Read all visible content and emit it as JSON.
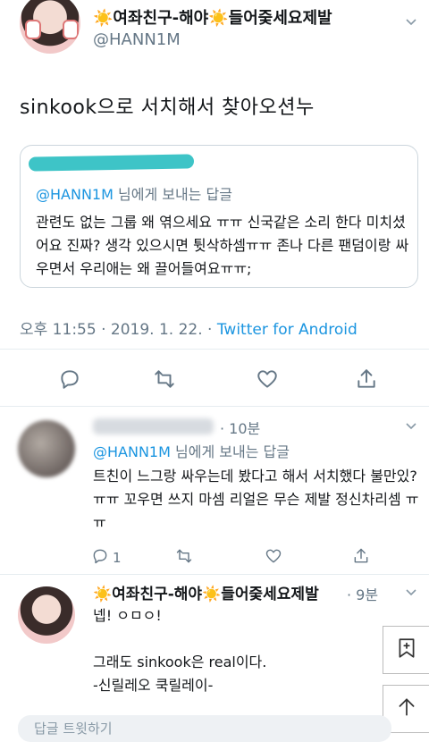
{
  "main_tweet": {
    "display_name": "☀️여좌친구-해야☀️들어줒세요제발",
    "handle": "@HANN1M",
    "text": "sinkook으로 서치해서 찾아오션누",
    "quote": {
      "reply_prefix": "@HANN1M",
      "reply_suffix": "님에게 보내는 답글",
      "body": "관련도 없는 그룹 왜 엮으세요 ㅠㅠ 신국같은 소리 한다 미치셨어요 진짜? 생각 있으시면 튓삭하셈ㅠㅠ 존나 다른 팬덤이랑 싸우면서 우리애는 왜 끌어들여요ㅠㅠ;"
    },
    "timestamp": "오후 11:55 · 2019. 1. 22. · ",
    "source": "Twitter for Android"
  },
  "reply1": {
    "time": "· 10분",
    "reply_prefix": "@HANN1M",
    "reply_suffix": "님에게 보내는 답글",
    "body": "트친이 느그랑 싸우는데 봤다고 해서 서치했다 불만있? ㅠㅠ 꼬우면 쓰지 마셈 리얼은 무슨 제발 정신차리셈 ㅠㅠ",
    "reply_count": "1"
  },
  "reply2": {
    "display_name": "☀️여좌친구-해야☀️들어줒세요제발",
    "time": "· 9분",
    "body": "넵! ㅇㅁㅇ!\n\n그래도 sinkook은 real이다.\n-신릴레오 쿡릴레이-"
  },
  "compose": {
    "placeholder": "답글 트윗하기"
  },
  "icons": {
    "reply": "reply-icon",
    "retweet": "retweet-icon",
    "like": "heart-icon",
    "share": "share-icon",
    "bookmark_add": "bookmark-add-icon",
    "scroll_top": "arrow-up-icon",
    "chevron": "chevron-down-icon"
  },
  "colors": {
    "link": "#1b95e0",
    "muted": "#657786",
    "scribble": "#3ec4c7"
  }
}
